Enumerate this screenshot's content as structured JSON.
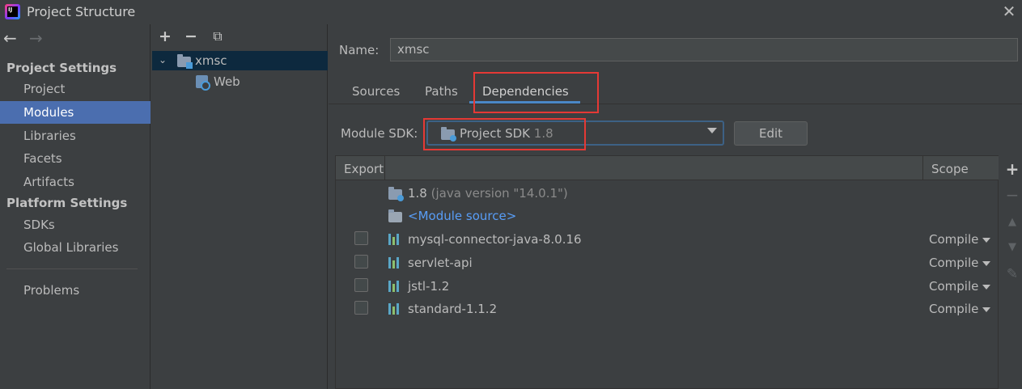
{
  "window": {
    "title": "Project Structure",
    "app_icon_text": "IJ"
  },
  "nav": {
    "back_arrow": "←",
    "forward_arrow": "→",
    "project_settings_header": "Project Settings",
    "project_settings_items": [
      "Project",
      "Modules",
      "Libraries",
      "Facets",
      "Artifacts"
    ],
    "platform_settings_header": "Platform Settings",
    "platform_settings_items": [
      "SDKs",
      "Global Libraries"
    ],
    "problems_label": "Problems",
    "selected": "Modules"
  },
  "tree": {
    "toolbar": {
      "add": "+",
      "remove": "−",
      "copy": "⧉"
    },
    "module_name": "xmsc",
    "child_name": "Web"
  },
  "module": {
    "name_label": "Name:",
    "name_value": "xmsc",
    "tabs": [
      "Sources",
      "Paths",
      "Dependencies"
    ],
    "active_tab": "Dependencies",
    "sdk_label": "Module SDK:",
    "sdk_value": "Project SDK",
    "sdk_version": "1.8",
    "edit_button": "Edit"
  },
  "dependencies": {
    "headers": {
      "export": "Export",
      "scope": "Scope"
    },
    "jdk_row": {
      "name": "1.8",
      "detail": "(java version \"14.0.1\")"
    },
    "module_source": "<Module source>",
    "libraries": [
      {
        "name": "mysql-connector-java-8.0.16",
        "scope": "Compile"
      },
      {
        "name": "servlet-api",
        "scope": "Compile"
      },
      {
        "name": "jstl-1.2",
        "scope": "Compile"
      },
      {
        "name": "standard-1.1.2",
        "scope": "Compile"
      }
    ]
  },
  "side_tools": {
    "add": "+",
    "remove": "−",
    "up": "▲",
    "down": "▼",
    "edit": "✎"
  },
  "colors": {
    "background": "#3c3f41",
    "selection": "#4b6eaf",
    "tree_selection": "#0d293e",
    "accent_tab": "#4a88c7",
    "link": "#589df6",
    "highlight_box": "#e53935"
  }
}
